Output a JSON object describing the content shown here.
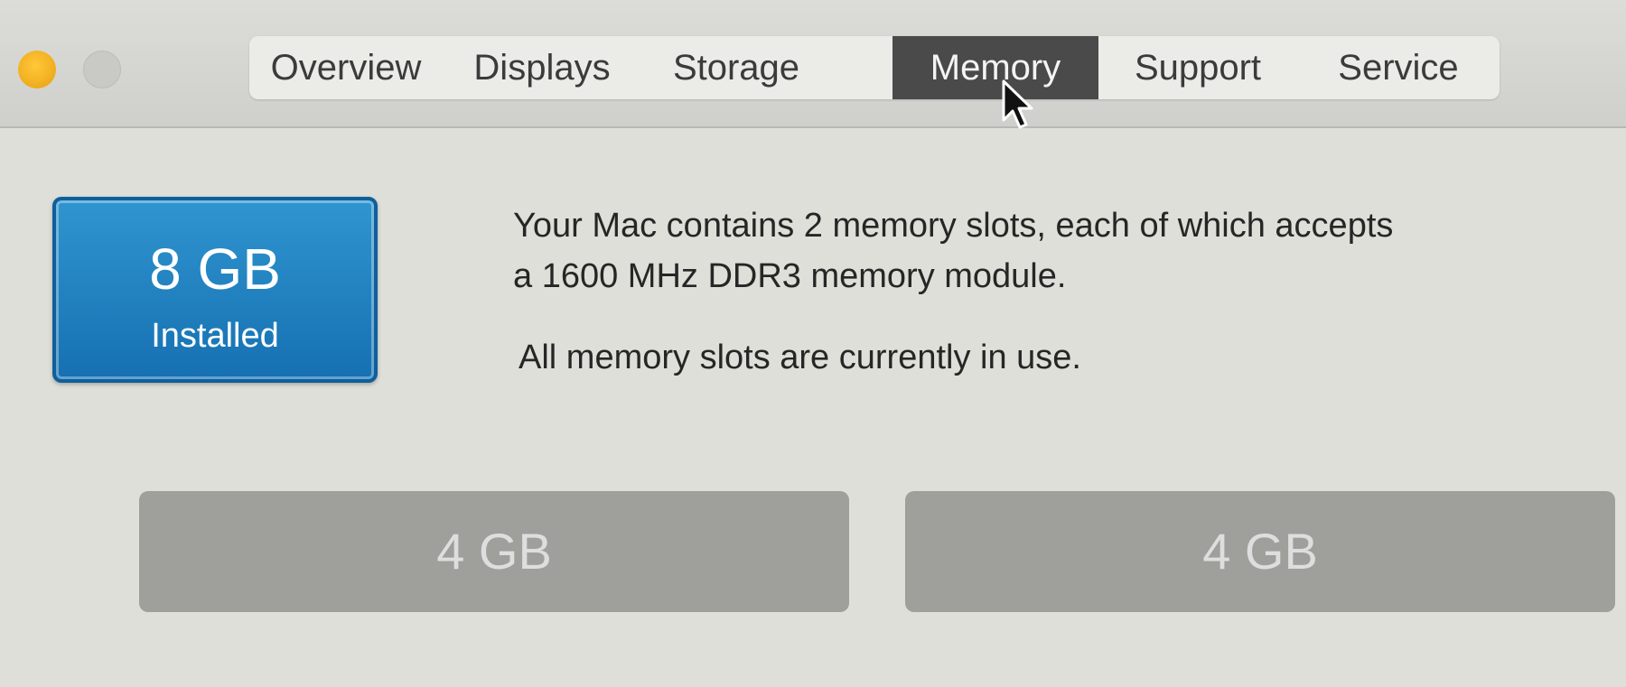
{
  "window": {
    "controls": [
      "minimize-button",
      "zoom-button"
    ],
    "colors": {
      "minimize": "#f5b120",
      "inactive": "#c9c9c5"
    }
  },
  "tabs": [
    {
      "label": "Overview",
      "active": false
    },
    {
      "label": "Displays",
      "active": false
    },
    {
      "label": "Storage",
      "active": false
    },
    {
      "label": "Memory",
      "active": true
    },
    {
      "label": "Support",
      "active": false
    },
    {
      "label": "Service",
      "active": false
    }
  ],
  "memory": {
    "amount": "8 GB",
    "status": "Installed",
    "accent_color": "#1f82c1",
    "info_line1": "Your Mac contains 2 memory slots, each of which accepts",
    "info_line2": "a 1600 MHz DDR3 memory module.",
    "slots_status": "All memory slots are currently in use.",
    "slots": [
      {
        "label": "4 GB"
      },
      {
        "label": "4 GB"
      }
    ]
  },
  "icons": {
    "cursor": "arrow-cursor-icon"
  }
}
